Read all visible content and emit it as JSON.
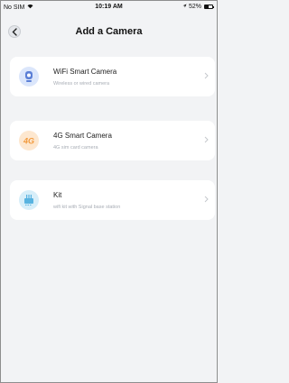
{
  "status_bar": {
    "carrier": "No SIM",
    "time": "10:19 AM",
    "battery": "52%",
    "battery_level": 0.52
  },
  "nav": {
    "title": "Add a Camera",
    "back_icon": "chevron-left-icon"
  },
  "options": [
    {
      "title": "WiFi Smart Camera",
      "subtitle": "Wireless or wired camera",
      "icon": "wifi-camera-icon",
      "icon_bg": "#dbe6fb",
      "icon_color": "#5b7fd6"
    },
    {
      "title": "4G Smart Camera",
      "subtitle": "4G sim card camera",
      "icon": "4g-icon",
      "icon_label": "4G",
      "icon_bg": "#fde7cf",
      "icon_color": "#f29a3d"
    },
    {
      "title": "Kit",
      "subtitle": "wifi kit with Signal base station",
      "icon": "base-station-icon",
      "icon_bg": "#d7eef9",
      "icon_color": "#58b3e0"
    }
  ],
  "colors": {
    "background": "#f2f3f5",
    "card": "#ffffff",
    "subtitle_text": "#a8adb5"
  }
}
